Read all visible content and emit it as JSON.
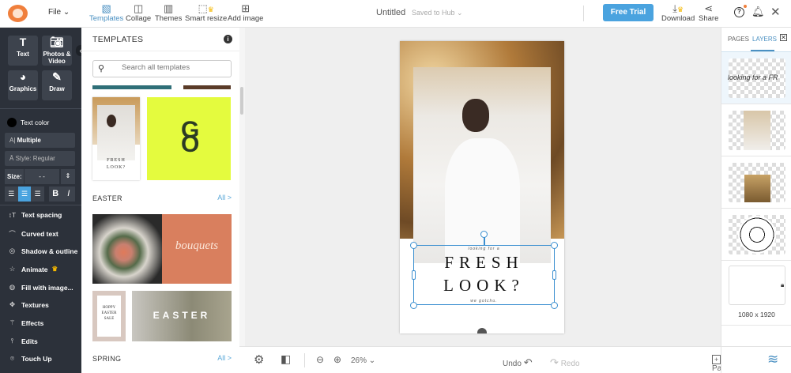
{
  "header": {
    "file": "File",
    "tools": [
      {
        "label": "Templates",
        "icon": "templates-icon"
      },
      {
        "label": "Collage",
        "icon": "collage-icon"
      },
      {
        "label": "Themes",
        "icon": "themes-icon"
      },
      {
        "label": "Smart resize",
        "icon": "smart-resize-icon"
      },
      {
        "label": "Add image",
        "icon": "add-image-icon"
      }
    ],
    "title": "Untitled",
    "save_status": "Saved to Hub",
    "free_trial": "Free Trial",
    "download": "Download",
    "share": "Share"
  },
  "sidebar": {
    "big_buttons": [
      "Text",
      "Photos & Video",
      "Graphics",
      "Draw"
    ],
    "text_color": "Text color",
    "font": "Multiple",
    "style": "Style: Regular",
    "size_label": "Size:",
    "size_value": "- -",
    "tools": [
      "Text spacing",
      "Curved text",
      "Shadow & outline",
      "Animate",
      "Fill with image...",
      "Textures",
      "Effects",
      "Edits",
      "Touch Up"
    ]
  },
  "templates": {
    "title": "TEMPLATES",
    "search_placeholder": "Search all templates",
    "sections": [
      {
        "name": "EASTER",
        "all": "All >"
      },
      {
        "name": "SPRING",
        "all": "All >"
      }
    ],
    "thumb_text": {
      "fresh": "FRESH",
      "look": "LOOK?",
      "bouquets": "bouquets",
      "hoppy": "HOPPY EASTER SALE",
      "easter": "EASTER"
    }
  },
  "canvas": {
    "small_top": "looking for a",
    "line1": "FRESH",
    "line2": "LOOK?",
    "small_bottom": "we gotchu."
  },
  "bottom": {
    "zoom": "26%",
    "undo": "Undo",
    "redo": "Redo",
    "pages": "Pages"
  },
  "right": {
    "tabs": [
      "PAGES",
      "LAYERS"
    ],
    "layer_text": "looking for a FR",
    "size": "1080 x 1920"
  },
  "colors": {
    "accent": "#4aa3df",
    "sidebar": "#2c313a",
    "lime": "#e4fb3e",
    "coral": "#d97f5e"
  }
}
